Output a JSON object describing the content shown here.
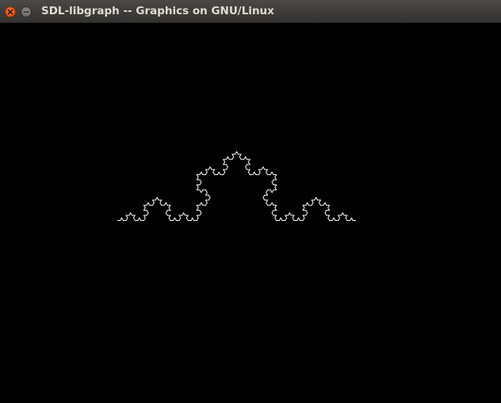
{
  "window": {
    "title": "SDL-libgraph -- Graphics on GNU/Linux"
  },
  "titlebar_buttons": {
    "close_icon": "close-icon",
    "minimize_icon": "minimize-icon"
  },
  "canvas": {
    "background_color": "#000000",
    "stroke_color": "#ffffff",
    "figure": "koch-curve"
  }
}
